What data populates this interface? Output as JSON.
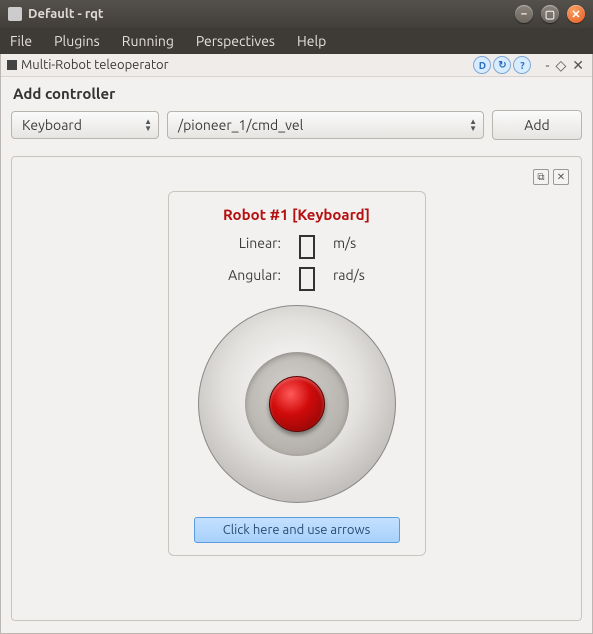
{
  "window": {
    "title": "Default - rqt"
  },
  "menubar": [
    "File",
    "Plugins",
    "Running",
    "Perspectives",
    "Help"
  ],
  "dock": {
    "title": "Multi-Robot teleoperator",
    "icons": {
      "d": "D",
      "reload": "↻",
      "help": "?"
    }
  },
  "section_label": "Add controller",
  "controller_type": "Keyboard",
  "topic": "/pioneer_1/cmd_vel",
  "add_label": "Add",
  "card": {
    "title": "Robot #1 [Keyboard]",
    "linear_label": "Linear:",
    "linear_unit": "m/s",
    "angular_label": "Angular:",
    "angular_unit": "rad/s",
    "hint": "Click here and use arrows"
  }
}
